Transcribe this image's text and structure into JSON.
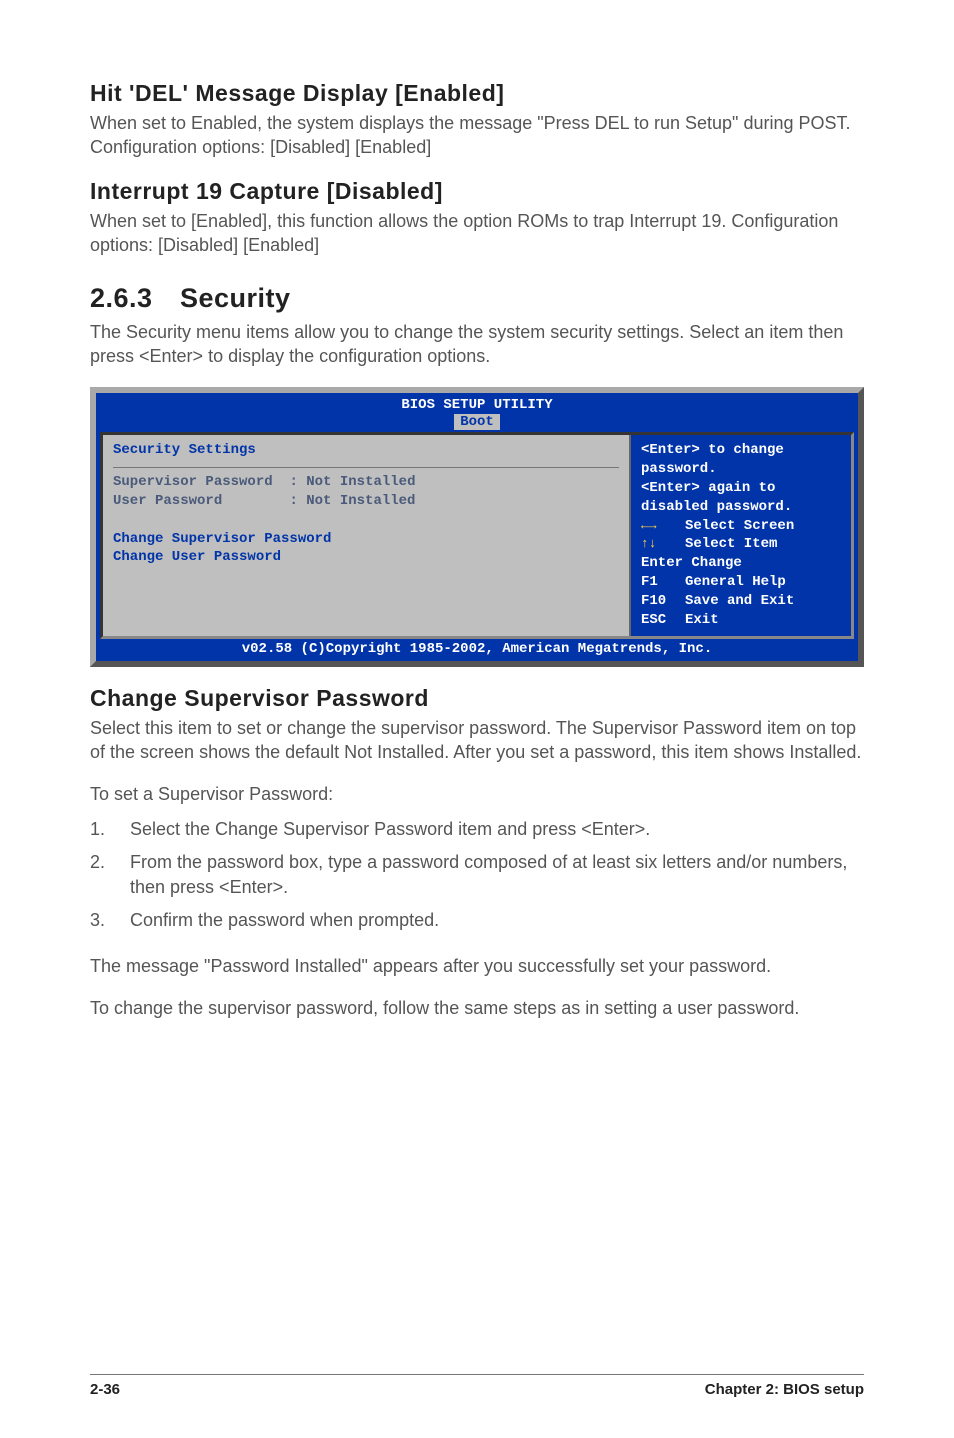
{
  "headings": {
    "hit_del": "Hit 'DEL' Message Display [Enabled]",
    "interrupt": "Interrupt 19 Capture [Disabled]",
    "section_num": "2.6.3",
    "section_title": "Security",
    "change_sup": "Change Supervisor Password"
  },
  "paragraphs": {
    "hit_del": "When set to Enabled, the system displays the message \"Press DEL to run Setup\" during POST. Configuration options: [Disabled] [Enabled]",
    "interrupt": "When set to [Enabled], this function allows the option ROMs to trap Interrupt 19. Configuration options: [Disabled] [Enabled]",
    "security_intro": "The Security menu items allow you to change the system security settings. Select an item then press <Enter> to display the configuration options.",
    "change_sup": "Select this item to set or change the supervisor password. The Supervisor Password item on top of the screen shows the default Not Installed. After you set a password, this item shows Installed.",
    "to_set_sup": "To set a Supervisor Password:",
    "pw_installed": "The message \"Password Installed\" appears after you successfully set your password.",
    "to_change": "To change the supervisor password, follow the same steps as in setting a user password."
  },
  "steps": {
    "s1": "Select the Change Supervisor Password item and press <Enter>.",
    "s2": "From the password box, type a password composed of at least six letters and/or numbers, then press <Enter>.",
    "s3": "Confirm the password when prompted.",
    "n1": "1.",
    "n2": "2.",
    "n3": "3."
  },
  "bios": {
    "title": "BIOS SETUP UTILITY",
    "tab": "Boot",
    "left_title": "Security Settings",
    "sup_label": "Supervisor Password",
    "sup_val": ": Not Installed",
    "user_label": "User Password",
    "user_val": ": Not Installed",
    "change_sup": "Change Supervisor Password",
    "change_user": "Change User Password",
    "right_l1": "<Enter> to change",
    "right_l2": "password.",
    "right_l3": "<Enter> again to",
    "right_l4": "disabled password.",
    "help": {
      "arrows_lr": "←→",
      "arrows_ud": "↑↓",
      "select_screen": "Select Screen",
      "select_item": "Select Item",
      "enter_label": "Enter Change",
      "f1": "F1",
      "f1_text": "General Help",
      "f10": "F10",
      "f10_text": "Save and Exit",
      "esc": "ESC",
      "esc_text": "Exit"
    },
    "footer": "v02.58 (C)Copyright 1985-2002, American Megatrends, Inc."
  },
  "footer": {
    "left": "2-36",
    "right": "Chapter 2: BIOS setup"
  }
}
